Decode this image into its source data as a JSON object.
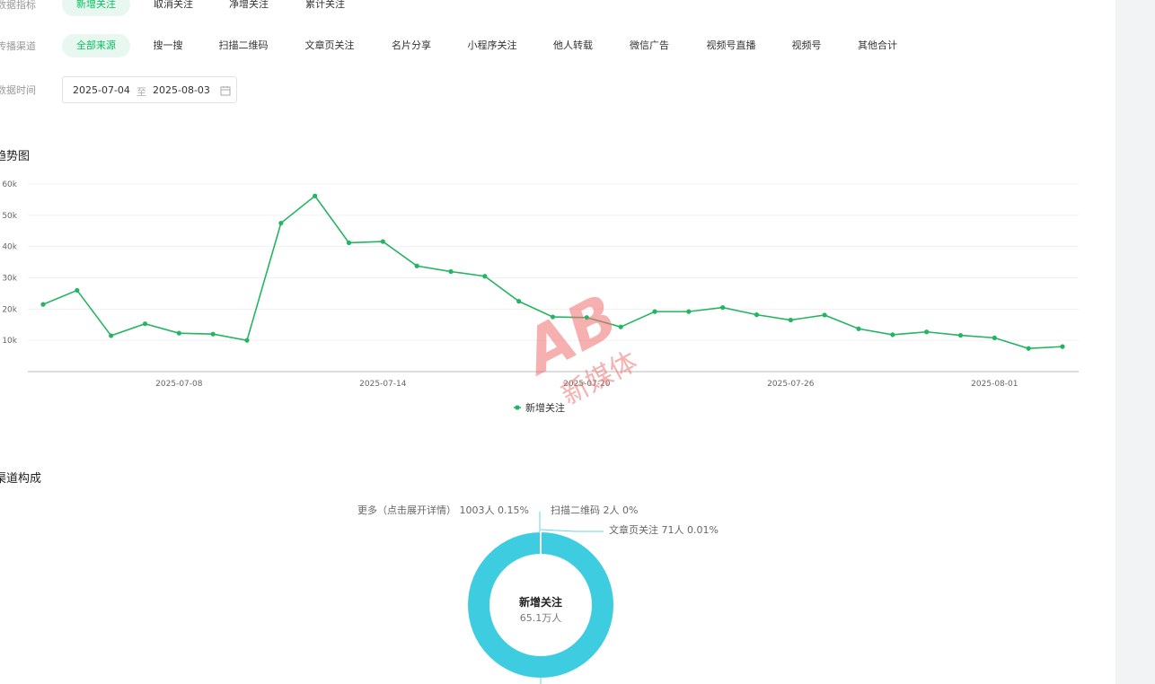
{
  "filters": {
    "metric_label": "数据指标",
    "metric_tabs": [
      {
        "label": "新增关注",
        "active": true
      },
      {
        "label": "取消关注",
        "active": false
      },
      {
        "label": "净增关注",
        "active": false
      },
      {
        "label": "累计关注",
        "active": false
      }
    ],
    "channel_label": "传播渠道",
    "channel_tabs": [
      {
        "label": "全部来源",
        "active": true
      },
      {
        "label": "搜一搜",
        "active": false
      },
      {
        "label": "扫描二维码",
        "active": false
      },
      {
        "label": "文章页关注",
        "active": false
      },
      {
        "label": "名片分享",
        "active": false
      },
      {
        "label": "小程序关注",
        "active": false
      },
      {
        "label": "他人转载",
        "active": false
      },
      {
        "label": "微信广告",
        "active": false
      },
      {
        "label": "视频号直播",
        "active": false
      },
      {
        "label": "视频号",
        "active": false
      },
      {
        "label": "其他合计",
        "active": false
      }
    ],
    "time_label": "数据时间",
    "date_start": "2025-07-04",
    "date_sep": "至",
    "date_end": "2025-08-03",
    "calendar_icon": "calendar-icon"
  },
  "trend": {
    "section_title": "趋势图",
    "legend_label": "新增关注"
  },
  "channel": {
    "section_title": "渠道构成",
    "center_title": "新增关注",
    "center_value": "65.1万人",
    "callouts": [
      "更多（点击展开详情） 1003人 0.15%",
      "扫描二维码 2人 0%",
      "文章页关注 71人 0.01%"
    ]
  },
  "watermark": {
    "logo_text": "新媒体"
  },
  "colors": {
    "accent": "#07c160",
    "donut": "#3ecde0",
    "line": "#23b561"
  },
  "chart_data": [
    {
      "type": "line",
      "x": [
        "2025-07-04",
        "2025-07-05",
        "2025-07-06",
        "2025-07-07",
        "2025-07-08",
        "2025-07-09",
        "2025-07-10",
        "2025-07-11",
        "2025-07-12",
        "2025-07-13",
        "2025-07-14",
        "2025-07-15",
        "2025-07-16",
        "2025-07-17",
        "2025-07-18",
        "2025-07-19",
        "2025-07-20",
        "2025-07-21",
        "2025-07-22",
        "2025-07-23",
        "2025-07-24",
        "2025-07-25",
        "2025-07-26",
        "2025-07-27",
        "2025-07-28",
        "2025-07-29",
        "2025-07-30",
        "2025-07-31",
        "2025-08-01",
        "2025-08-02",
        "2025-08-03"
      ],
      "x_tick_labels": [
        "2025-07-08",
        "2025-07-14",
        "2025-07-20",
        "2025-07-26",
        "2025-08-01"
      ],
      "series": [
        {
          "name": "新增关注",
          "values": [
            21500,
            26000,
            11500,
            15300,
            12300,
            12000,
            10000,
            47500,
            56200,
            41200,
            41600,
            33800,
            32000,
            30500,
            22500,
            17500,
            17300,
            14300,
            19200,
            19200,
            20500,
            18200,
            16500,
            18100,
            13700,
            11800,
            12700,
            11600,
            10800,
            7400,
            8000
          ]
        }
      ],
      "y_tick_labels": [
        "10k",
        "20k",
        "30k",
        "40k",
        "50k",
        "60k"
      ],
      "ylim": [
        0,
        60000
      ],
      "grid": true,
      "legend": "bottom-center"
    },
    {
      "type": "pie",
      "labels": [
        "更多（点击展开详情）",
        "扫描二维码",
        "文章页关注"
      ],
      "values": [
        1003,
        2,
        71
      ],
      "percent_labels": [
        "0.15%",
        "0%",
        "0.01%"
      ]
    }
  ]
}
